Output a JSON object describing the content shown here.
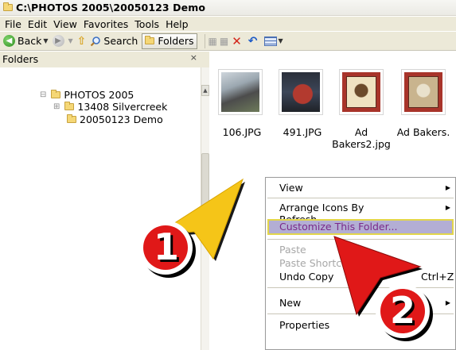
{
  "window": {
    "title": "C:\\PHOTOS 2005\\20050123 Demo"
  },
  "menubar": [
    "File",
    "Edit",
    "View",
    "Favorites",
    "Tools",
    "Help"
  ],
  "toolbar": {
    "back_label": "Back",
    "search_label": "Search",
    "folders_label": "Folders"
  },
  "folders_pane": {
    "header": "Folders",
    "close_glyph": "×",
    "tree": [
      {
        "label": "PHOTOS 2005"
      },
      {
        "label": "13408 Silvercreek"
      },
      {
        "label": "20050123 Demo"
      }
    ]
  },
  "files": [
    {
      "name": "106.JPG"
    },
    {
      "name": "491.JPG"
    },
    {
      "name": "Ad Bakers2.jpg"
    },
    {
      "name": "Ad Bakers."
    }
  ],
  "context_menu": {
    "items": [
      {
        "label": "View",
        "submenu": true
      },
      {
        "label": "Arrange Icons By",
        "submenu": true
      },
      {
        "label": "Refresh"
      },
      {
        "label": "Customize This Folder...",
        "highlighted": true
      },
      {
        "label": "Paste",
        "disabled": true
      },
      {
        "label": "Paste Shortcut",
        "disabled": true
      },
      {
        "label": "Undo Copy",
        "shortcut": "Ctrl+Z"
      },
      {
        "label": "New",
        "submenu": true
      },
      {
        "label": "Properties"
      }
    ]
  },
  "annotations": {
    "step1": "1",
    "step2": "2",
    "arrow1_color": "#f5c518",
    "arrow2_color": "#e01818"
  }
}
